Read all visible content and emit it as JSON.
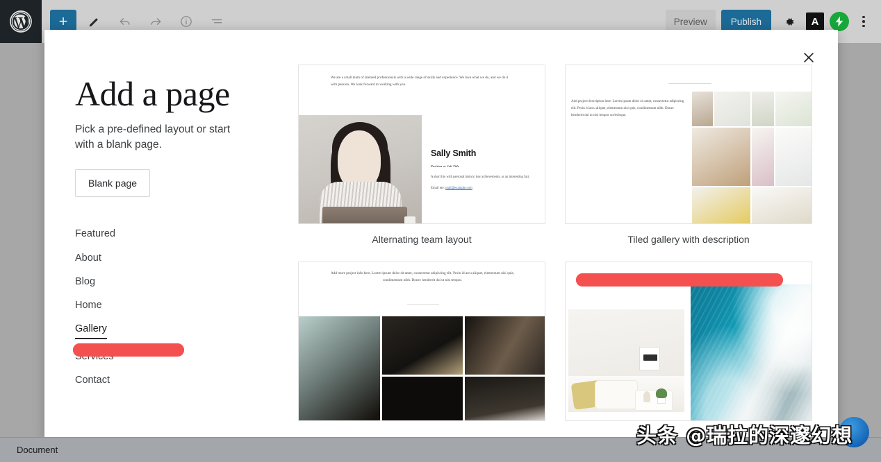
{
  "adminbar": {
    "logo_icon": "wordpress-logo-icon",
    "left_tools": [
      {
        "name": "add-block-button",
        "icon": "plus-icon",
        "label": "+"
      },
      {
        "name": "edit-mode-button",
        "icon": "pencil-icon",
        "label": ""
      },
      {
        "name": "undo-button",
        "icon": "undo-arrow-icon",
        "label": ""
      },
      {
        "name": "redo-button",
        "icon": "redo-arrow-icon",
        "label": ""
      },
      {
        "name": "details-button",
        "icon": "info-circle-icon",
        "label": ""
      },
      {
        "name": "list-view-button",
        "icon": "list-view-icon",
        "label": ""
      }
    ],
    "preview_label": "Preview",
    "publish_label": "Publish",
    "settings_icon": "gear-icon",
    "jetpack_icon_label": "A",
    "more_menu_icon": "kebab-menu-icon"
  },
  "statusbar": {
    "breadcrumb": "Document"
  },
  "modal": {
    "close_icon": "close-x-icon",
    "title": "Add a page",
    "subtitle": "Pick a pre-defined layout or start with a blank page.",
    "blank_button": "Blank page",
    "nav": [
      {
        "label": "Featured",
        "active": false,
        "redacted": false
      },
      {
        "label": "About",
        "active": false,
        "redacted": false
      },
      {
        "label": "Blog",
        "active": false,
        "redacted": false
      },
      {
        "label": "Home",
        "active": false,
        "redacted": false
      },
      {
        "label": "Gallery",
        "active": true,
        "redacted": false
      },
      {
        "label": "Services",
        "active": false,
        "redacted": true
      },
      {
        "label": "Contact",
        "active": false,
        "redacted": false
      }
    ],
    "templates": [
      {
        "caption": "Alternating team layout",
        "intro": "We are a small team of talented professionals with a wide range of skills and experience. We love what we do, and we do it with passion. We look forward to working with you.",
        "person_name": "Sally Smith",
        "person_role": "Position or Job Title",
        "person_bio": "A short bio with personal history, key achievements, or an interesting fact.",
        "person_email_prefix": "Email me: ",
        "person_email": "mail@example.com"
      },
      {
        "caption": "Tiled gallery with description",
        "description": "Add project description here. Lorem ipsum dolor sit amet, consectetur adipiscing elit. Proin id arcu aliquet, elementum nisi quis, condimentum nibh. Donec hendrerit dui ut nisi tempor scelerisque."
      },
      {
        "caption": "",
        "description": "Add more project info here. Lorem ipsum dolor sit amet, consectetur adipiscing elit. Proin id arcu aliquet, elementum nisi quis, condimentum nibh. Donec hendrerit dui ut nisi tempor."
      },
      {
        "caption": ""
      }
    ]
  },
  "annotations": {
    "marker_color": "#f4504f",
    "nav_marker_target": "Services",
    "card_marker_target": "third template caption"
  },
  "watermark": {
    "text": "头条 @瑞拉的深邃幻想"
  },
  "colors": {
    "wp_dark": "#1d2327",
    "accent_blue": "#1c6a96",
    "marker_red": "#f4504f",
    "backdrop_gray": "#a7a7a7",
    "statusbar_gray": "#a3a6ab"
  }
}
